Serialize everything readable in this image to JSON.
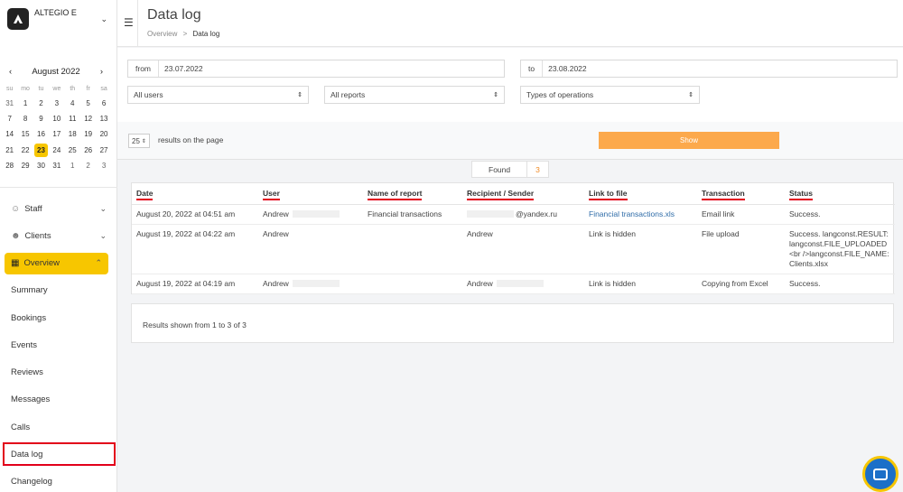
{
  "brand": {
    "name": "ALTEGIO E"
  },
  "calendar": {
    "month_label": "August 2022",
    "weekdays": [
      "su",
      "mo",
      "tu",
      "we",
      "th",
      "fr",
      "sa"
    ],
    "weeks": [
      [
        "31",
        "1",
        "2",
        "3",
        "4",
        "5",
        "6"
      ],
      [
        "7",
        "8",
        "9",
        "10",
        "11",
        "12",
        "13"
      ],
      [
        "14",
        "15",
        "16",
        "17",
        "18",
        "19",
        "20"
      ],
      [
        "21",
        "22",
        "23",
        "24",
        "25",
        "26",
        "27"
      ],
      [
        "28",
        "29",
        "30",
        "31",
        "1",
        "2",
        "3"
      ]
    ],
    "selected": "23"
  },
  "nav": {
    "staff": "Staff",
    "clients": "Clients",
    "overview": "Overview",
    "summary": "Summary",
    "bookings": "Bookings",
    "events": "Events",
    "reviews": "Reviews",
    "messages": "Messages",
    "calls": "Calls",
    "data_log": "Data log",
    "changelog": "Changelog"
  },
  "header": {
    "title": "Data log",
    "breadcrumb_parent": "Overview",
    "breadcrumb_sep": ">",
    "breadcrumb_current": "Data log"
  },
  "filters": {
    "from_label": "from",
    "from_value": "23.07.2022",
    "to_label": "to",
    "to_value": "23.08.2022",
    "users_select": "All users",
    "reports_select": "All reports",
    "operations_select": "Types of operations"
  },
  "results_bar": {
    "per_page": "25",
    "per_page_label": "results on the page",
    "show_button": "Show"
  },
  "found": {
    "label": "Found",
    "count": "3"
  },
  "table": {
    "columns": [
      "Date",
      "User",
      "Name of report",
      "Recipient / Sender",
      "Link to file",
      "Transaction",
      "Status"
    ],
    "rows": [
      [
        "August 20, 2022 at 04:51 am",
        "Andrew",
        "Financial transactions",
        "@yandex.ru",
        "Financial transactions.xls",
        "Email link",
        "Success."
      ],
      [
        "August 19, 2022 at 04:22 am",
        "Andrew",
        "",
        "Andrew",
        "Link is hidden",
        "File upload",
        "Success. langconst.RESULT: langconst.FILE_UPLOADED<br />langconst.FILE_NAME: Clients.xlsx"
      ],
      [
        "August 19, 2022 at 04:19 am",
        "Andrew",
        "",
        "Andrew",
        "Link is hidden",
        "Copying from Excel",
        "Success."
      ]
    ]
  },
  "results_shown": "Results shown from 1 to 3 of 3",
  "colors": {
    "accent": "#f7c600",
    "button": "#fca94c",
    "link": "#2f6ca8",
    "highlight": "#e2001a"
  }
}
